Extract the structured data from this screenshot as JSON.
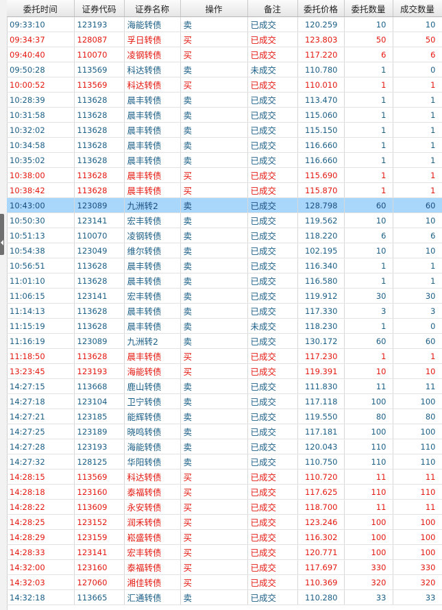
{
  "headers": [
    "委托时间",
    "证券代码",
    "证券名称",
    "操作",
    "备注",
    "委托价格",
    "委托数量",
    "成交数量"
  ],
  "selected_row": 12,
  "colors": {
    "buy": "#e4170f",
    "sell": "#1a5e86",
    "selected": "#a9d6fb"
  },
  "rows": [
    {
      "time": "09:33:10",
      "code": "123193",
      "name": "海能转债",
      "op": "卖",
      "note": "已成交",
      "price": "120.259",
      "qty": "10",
      "filled": "10"
    },
    {
      "time": "09:34:37",
      "code": "128087",
      "name": "孚日转债",
      "op": "买",
      "note": "已成交",
      "price": "123.803",
      "qty": "50",
      "filled": "50"
    },
    {
      "time": "09:40:40",
      "code": "110070",
      "name": "凌钢转债",
      "op": "买",
      "note": "已成交",
      "price": "117.220",
      "qty": "6",
      "filled": "6"
    },
    {
      "time": "09:50:28",
      "code": "113569",
      "name": "科达转债",
      "op": "卖",
      "note": "未成交",
      "price": "110.780",
      "qty": "1",
      "filled": "0"
    },
    {
      "time": "10:00:52",
      "code": "113569",
      "name": "科达转债",
      "op": "买",
      "note": "已成交",
      "price": "110.010",
      "qty": "1",
      "filled": "1"
    },
    {
      "time": "10:28:39",
      "code": "113628",
      "name": "晨丰转债",
      "op": "卖",
      "note": "已成交",
      "price": "113.470",
      "qty": "1",
      "filled": "1"
    },
    {
      "time": "10:31:58",
      "code": "113628",
      "name": "晨丰转债",
      "op": "卖",
      "note": "已成交",
      "price": "115.060",
      "qty": "1",
      "filled": "1"
    },
    {
      "time": "10:32:02",
      "code": "113628",
      "name": "晨丰转债",
      "op": "卖",
      "note": "已成交",
      "price": "115.150",
      "qty": "1",
      "filled": "1"
    },
    {
      "time": "10:34:58",
      "code": "113628",
      "name": "晨丰转债",
      "op": "卖",
      "note": "已成交",
      "price": "116.660",
      "qty": "1",
      "filled": "1"
    },
    {
      "time": "10:35:02",
      "code": "113628",
      "name": "晨丰转债",
      "op": "卖",
      "note": "已成交",
      "price": "116.660",
      "qty": "1",
      "filled": "1"
    },
    {
      "time": "10:38:00",
      "code": "113628",
      "name": "晨丰转债",
      "op": "买",
      "note": "已成交",
      "price": "115.690",
      "qty": "1",
      "filled": "1"
    },
    {
      "time": "10:38:42",
      "code": "113628",
      "name": "晨丰转债",
      "op": "买",
      "note": "已成交",
      "price": "115.870",
      "qty": "1",
      "filled": "1"
    },
    {
      "time": "10:43:00",
      "code": "123089",
      "name": "九洲转2",
      "op": "卖",
      "note": "已成交",
      "price": "128.798",
      "qty": "60",
      "filled": "60"
    },
    {
      "time": "10:50:30",
      "code": "123141",
      "name": "宏丰转债",
      "op": "卖",
      "note": "已成交",
      "price": "119.562",
      "qty": "10",
      "filled": "10"
    },
    {
      "time": "10:51:13",
      "code": "110070",
      "name": "凌钢转债",
      "op": "卖",
      "note": "已成交",
      "price": "118.220",
      "qty": "6",
      "filled": "6"
    },
    {
      "time": "10:54:38",
      "code": "123049",
      "name": "维尔转债",
      "op": "卖",
      "note": "已成交",
      "price": "102.195",
      "qty": "10",
      "filled": "10"
    },
    {
      "time": "10:56:51",
      "code": "113628",
      "name": "晨丰转债",
      "op": "卖",
      "note": "已成交",
      "price": "116.340",
      "qty": "1",
      "filled": "1"
    },
    {
      "time": "11:01:10",
      "code": "113628",
      "name": "晨丰转债",
      "op": "卖",
      "note": "已成交",
      "price": "116.580",
      "qty": "1",
      "filled": "1"
    },
    {
      "time": "11:06:15",
      "code": "123141",
      "name": "宏丰转债",
      "op": "卖",
      "note": "已成交",
      "price": "119.912",
      "qty": "30",
      "filled": "30"
    },
    {
      "time": "11:14:13",
      "code": "113628",
      "name": "晨丰转债",
      "op": "卖",
      "note": "已成交",
      "price": "117.330",
      "qty": "3",
      "filled": "3"
    },
    {
      "time": "11:15:19",
      "code": "113628",
      "name": "晨丰转债",
      "op": "卖",
      "note": "未成交",
      "price": "118.230",
      "qty": "1",
      "filled": "0"
    },
    {
      "time": "11:16:19",
      "code": "123089",
      "name": "九洲转2",
      "op": "卖",
      "note": "已成交",
      "price": "130.172",
      "qty": "60",
      "filled": "60"
    },
    {
      "time": "11:18:50",
      "code": "113628",
      "name": "晨丰转债",
      "op": "买",
      "note": "已成交",
      "price": "117.230",
      "qty": "1",
      "filled": "1"
    },
    {
      "time": "13:23:45",
      "code": "123193",
      "name": "海能转债",
      "op": "买",
      "note": "已成交",
      "price": "119.391",
      "qty": "10",
      "filled": "10"
    },
    {
      "time": "14:27:15",
      "code": "113668",
      "name": "鹿山转债",
      "op": "卖",
      "note": "已成交",
      "price": "111.830",
      "qty": "11",
      "filled": "11"
    },
    {
      "time": "14:27:18",
      "code": "123104",
      "name": "卫宁转债",
      "op": "卖",
      "note": "已成交",
      "price": "117.118",
      "qty": "100",
      "filled": "100"
    },
    {
      "time": "14:27:21",
      "code": "123185",
      "name": "能辉转债",
      "op": "卖",
      "note": "已成交",
      "price": "119.550",
      "qty": "80",
      "filled": "80"
    },
    {
      "time": "14:27:25",
      "code": "123189",
      "name": "晓鸣转债",
      "op": "卖",
      "note": "已成交",
      "price": "117.181",
      "qty": "100",
      "filled": "100"
    },
    {
      "time": "14:27:28",
      "code": "123193",
      "name": "海能转债",
      "op": "卖",
      "note": "已成交",
      "price": "120.043",
      "qty": "110",
      "filled": "110"
    },
    {
      "time": "14:27:32",
      "code": "128125",
      "name": "华阳转债",
      "op": "卖",
      "note": "已成交",
      "price": "110.750",
      "qty": "110",
      "filled": "110"
    },
    {
      "time": "14:28:15",
      "code": "113569",
      "name": "科达转债",
      "op": "买",
      "note": "已成交",
      "price": "110.720",
      "qty": "11",
      "filled": "11"
    },
    {
      "time": "14:28:18",
      "code": "123160",
      "name": "泰福转债",
      "op": "买",
      "note": "已成交",
      "price": "117.625",
      "qty": "110",
      "filled": "110"
    },
    {
      "time": "14:28:22",
      "code": "113609",
      "name": "永安转债",
      "op": "买",
      "note": "已成交",
      "price": "118.700",
      "qty": "11",
      "filled": "11"
    },
    {
      "time": "14:28:25",
      "code": "123152",
      "name": "润禾转债",
      "op": "买",
      "note": "已成交",
      "price": "123.246",
      "qty": "100",
      "filled": "100"
    },
    {
      "time": "14:28:29",
      "code": "123159",
      "name": "崧盛转债",
      "op": "买",
      "note": "已成交",
      "price": "116.302",
      "qty": "100",
      "filled": "100"
    },
    {
      "time": "14:28:33",
      "code": "123141",
      "name": "宏丰转债",
      "op": "买",
      "note": "已成交",
      "price": "120.771",
      "qty": "100",
      "filled": "100"
    },
    {
      "time": "14:32:00",
      "code": "123160",
      "name": "泰福转债",
      "op": "买",
      "note": "已成交",
      "price": "117.697",
      "qty": "330",
      "filled": "330"
    },
    {
      "time": "14:32:03",
      "code": "127060",
      "name": "湘佳转债",
      "op": "买",
      "note": "已成交",
      "price": "110.369",
      "qty": "320",
      "filled": "320"
    },
    {
      "time": "14:32:18",
      "code": "113665",
      "name": "汇通转债",
      "op": "卖",
      "note": "已成交",
      "price": "110.280",
      "qty": "33",
      "filled": "33"
    }
  ]
}
